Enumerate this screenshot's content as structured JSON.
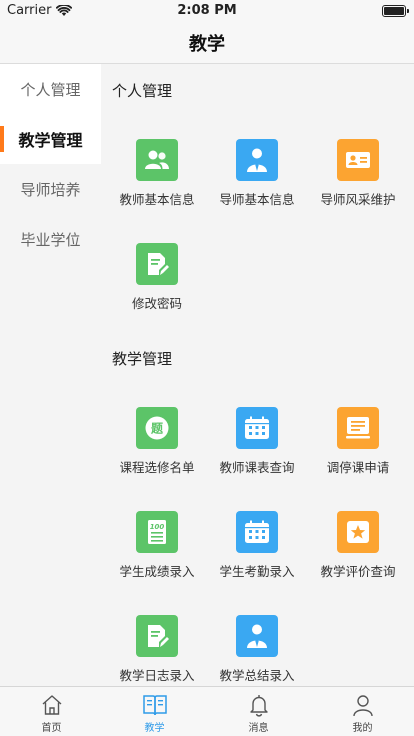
{
  "status_bar": {
    "carrier": "Carrier",
    "time": "2:08 PM"
  },
  "nav": {
    "title": "教学"
  },
  "sidebar": {
    "items": [
      {
        "label": "个人管理",
        "active": false
      },
      {
        "label": "教学管理",
        "active": true
      },
      {
        "label": "导师培养",
        "active": false
      },
      {
        "label": "毕业学位",
        "active": false
      }
    ]
  },
  "sections": [
    {
      "title": "个人管理",
      "tiles": [
        {
          "label": "教师基本信息",
          "icon": "users-icon",
          "color": "#5cc468"
        },
        {
          "label": "导师基本信息",
          "icon": "person-tie-icon",
          "color": "#3aa8f2"
        },
        {
          "label": "导师风采维护",
          "icon": "id-card-icon",
          "color": "#fca431"
        },
        {
          "label": "修改密码",
          "icon": "edit-document-icon",
          "color": "#5cc468"
        }
      ]
    },
    {
      "title": "教学管理",
      "tiles": [
        {
          "label": "课程选修名单",
          "icon": "question-badge-icon",
          "color": "#5cc468",
          "glyph": "题"
        },
        {
          "label": "教师课表查询",
          "icon": "calendar-icon",
          "color": "#3aa8f2"
        },
        {
          "label": "调停课申请",
          "icon": "monitor-form-icon",
          "color": "#fca431"
        },
        {
          "label": "学生成绩录入",
          "icon": "score-sheet-icon",
          "color": "#5cc468",
          "glyph": "100"
        },
        {
          "label": "学生考勤录入",
          "icon": "calendar-icon",
          "color": "#3aa8f2"
        },
        {
          "label": "教学评价查询",
          "icon": "star-icon",
          "color": "#fca431"
        },
        {
          "label": "教学日志录入",
          "icon": "edit-document-icon",
          "color": "#5cc468"
        },
        {
          "label": "教学总结录入",
          "icon": "person-tie-icon",
          "color": "#3aa8f2"
        }
      ]
    }
  ],
  "tab_bar": {
    "tabs": [
      {
        "label": "首页",
        "icon": "home-icon",
        "active": false
      },
      {
        "label": "教学",
        "icon": "book-icon",
        "active": true
      },
      {
        "label": "消息",
        "icon": "bell-icon",
        "active": false
      },
      {
        "label": "我的",
        "icon": "user-icon",
        "active": false
      }
    ]
  },
  "colors": {
    "accent": "#ff7a1a",
    "tab_active": "#2f9be8",
    "green": "#5cc468",
    "blue": "#3aa8f2",
    "orange": "#fca431"
  }
}
